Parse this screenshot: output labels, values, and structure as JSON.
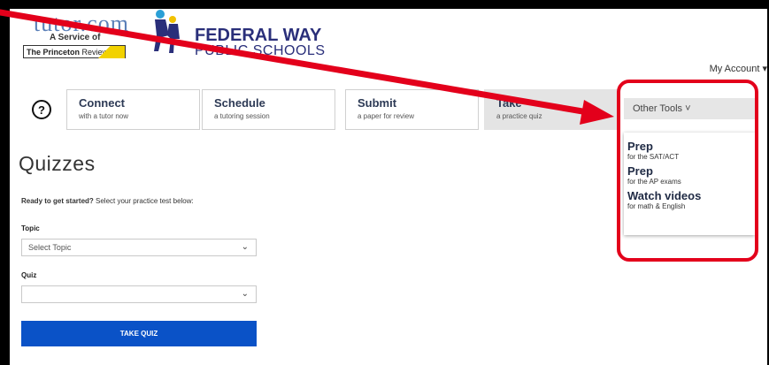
{
  "logo": {
    "tutor_word": "tutor.com",
    "service_line": "A Service of",
    "princeton_bold": "The Princeton",
    "princeton_rest": " Review",
    "district_line1": "FEDERAL WAY",
    "district_line2": "PUBLIC SCHOOLS"
  },
  "header": {
    "my_account": "My Account ▾"
  },
  "nav": {
    "help_symbol": "?",
    "tabs": [
      {
        "title": "Connect",
        "sub": "with a tutor now"
      },
      {
        "title": "Schedule",
        "sub": "a tutoring session"
      },
      {
        "title": "Submit",
        "sub": "a paper for review"
      },
      {
        "title": "Take",
        "sub": "a practice quiz"
      }
    ],
    "other_tools": "Other Tools ˅"
  },
  "menu": {
    "items": [
      {
        "title": "Prep",
        "sub": "for the SAT/ACT"
      },
      {
        "title": "Prep",
        "sub": "for the AP exams"
      },
      {
        "title": "Watch videos",
        "sub": "for math & English"
      }
    ]
  },
  "main": {
    "title": "Quizzes",
    "intro_bold": "Ready to get started?",
    "intro_rest": " Select your practice test below:",
    "topic_label": "Topic",
    "topic_value": "Select Topic",
    "quiz_label": "Quiz",
    "quiz_value": "",
    "take_quiz": "TAKE QUIZ",
    "chevron": "⌄"
  },
  "colors": {
    "accent_blue": "#0a52c7",
    "annotation_red": "#e3001b"
  }
}
